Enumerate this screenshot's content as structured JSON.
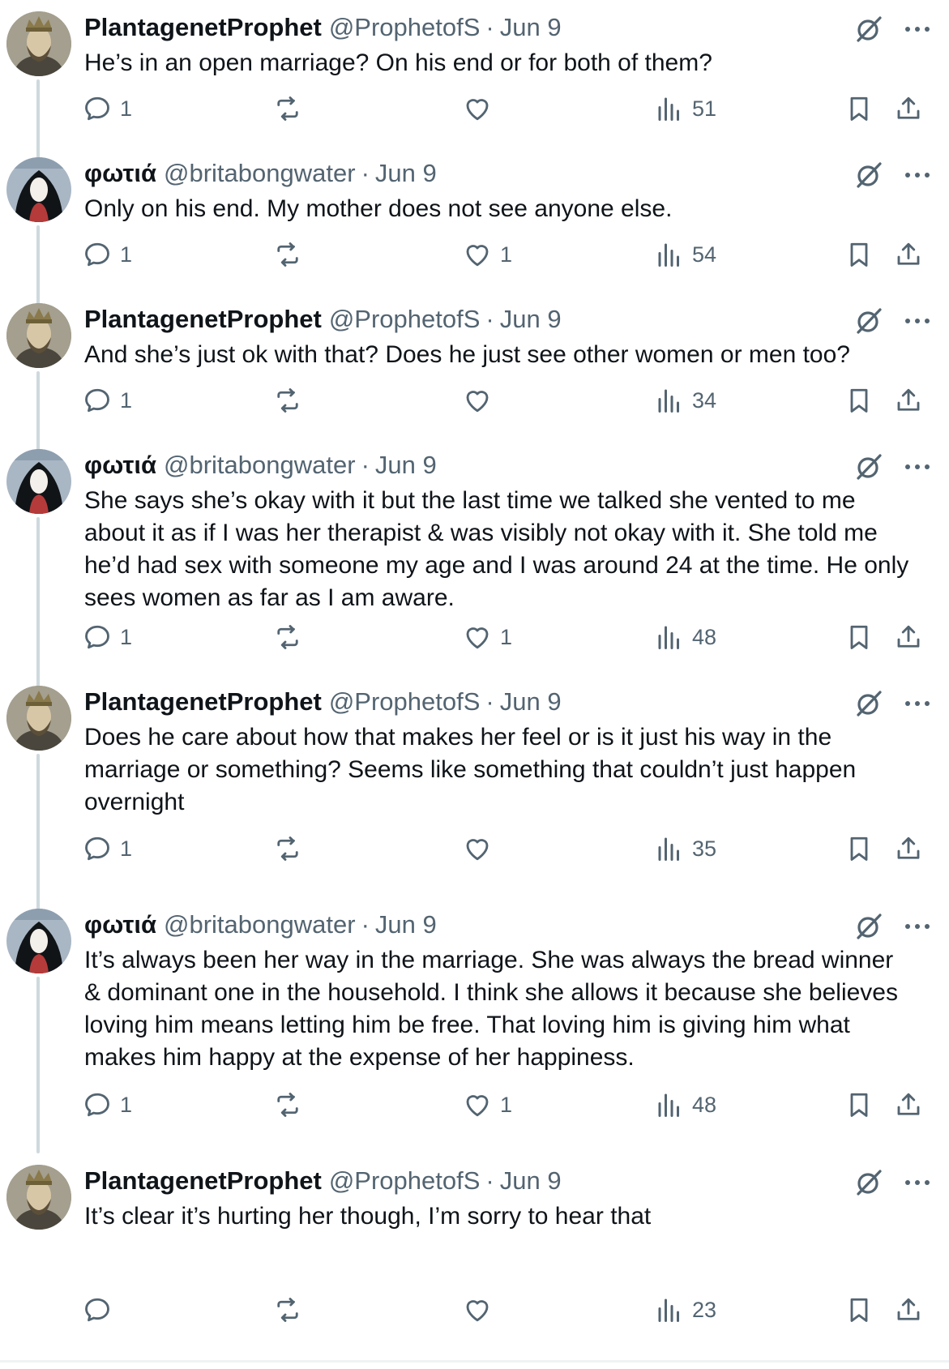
{
  "colors": {
    "text": "#0f1419",
    "secondary": "#536471",
    "thread_line": "#cfd9de"
  },
  "icons": {
    "reply": "reply-icon",
    "repost": "repost-icon",
    "like": "heart-icon",
    "views": "views-icon",
    "bookmark": "bookmark-icon",
    "share": "share-icon",
    "grok": "grok-icon",
    "more": "more-icon"
  },
  "tweets": [
    {
      "name": "PlantagenetProphet",
      "handle": "@ProphetofS",
      "separator": "·",
      "date": "Jun 9",
      "text": "He’s in an open marriage? On his end or for both of them?",
      "replies": "1",
      "reposts": "",
      "likes": "",
      "views": "51"
    },
    {
      "name": "φωτιά",
      "handle": "@britabongwater",
      "separator": "·",
      "date": "Jun 9",
      "text": "Only on his end. My mother does not see anyone else.",
      "replies": "1",
      "reposts": "",
      "likes": "1",
      "views": "54"
    },
    {
      "name": "PlantagenetProphet",
      "handle": "@ProphetofS",
      "separator": "·",
      "date": "Jun 9",
      "text": "And she’s just ok with that? Does he just see other women or men too?",
      "replies": "1",
      "reposts": "",
      "likes": "",
      "views": "34"
    },
    {
      "name": "φωτιά",
      "handle": "@britabongwater",
      "separator": "·",
      "date": "Jun 9",
      "text": "She says she’s okay with it but the last time we talked she vented to me\nabout it as if I was her therapist & was visibly not okay with it. She told me\nhe’d had sex with someone my age and I was around 24 at the time. He only\nsees women as far as I am aware.",
      "replies": "1",
      "reposts": "",
      "likes": "1",
      "views": "48"
    },
    {
      "name": "PlantagenetProphet",
      "handle": "@ProphetofS",
      "separator": "·",
      "date": "Jun 9",
      "text": "Does he care about how that makes her feel or is it just his way in the\nmarriage or something? Seems like something that couldn’t just happen\novernight",
      "replies": "1",
      "reposts": "",
      "likes": "",
      "views": "35"
    },
    {
      "name": "φωτιά",
      "handle": "@britabongwater",
      "separator": "·",
      "date": "Jun 9",
      "text": "It’s always been her way in the marriage. She was always the bread winner\n& dominant one in the household. I think she allows it because she believes\nloving him means letting him be free. That loving him is giving him what\nmakes him happy at the expense of her happiness.",
      "replies": "1",
      "reposts": "",
      "likes": "1",
      "views": "48"
    },
    {
      "name": "PlantagenetProphet",
      "handle": "@ProphetofS",
      "separator": "·",
      "date": "Jun 9",
      "text": "It’s clear it’s hurting her though, I’m sorry to hear that",
      "replies": "",
      "reposts": "",
      "likes": "",
      "views": "23"
    }
  ]
}
